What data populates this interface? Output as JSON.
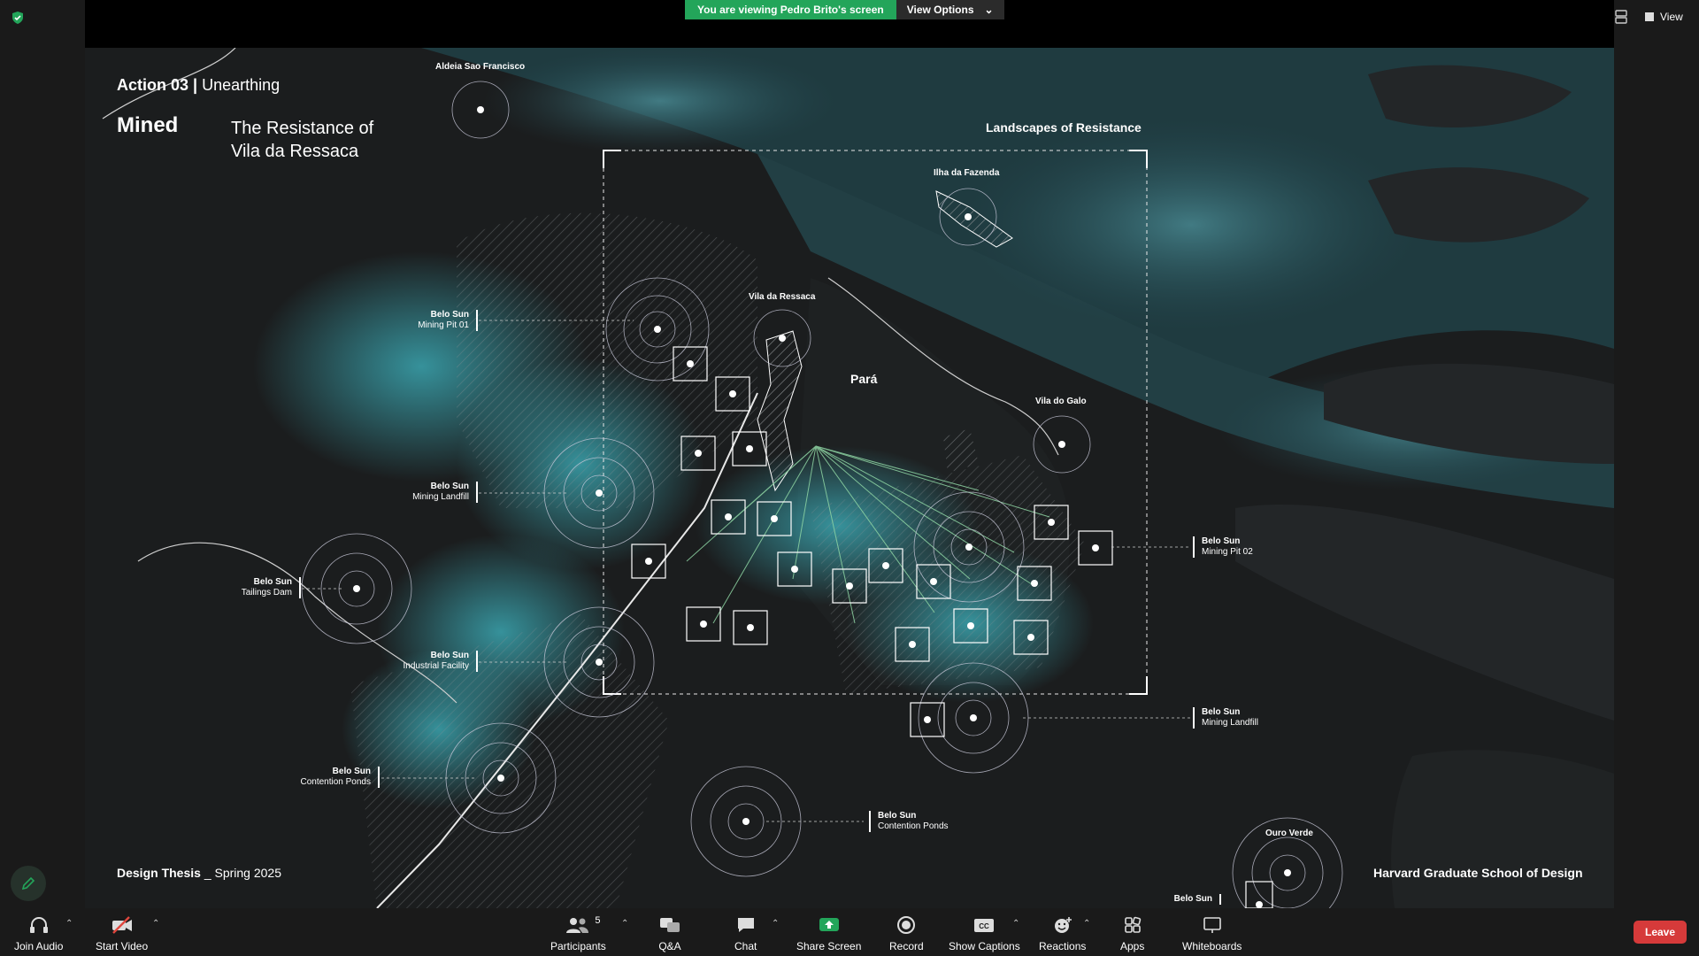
{
  "banner": {
    "text": "You are viewing Pedro Brito's screen",
    "view_options": "View Options"
  },
  "top_right": {
    "view_label": "View"
  },
  "slide": {
    "action": "Action 03",
    "action_sub": "Unearthing",
    "mined": "Mined",
    "subtitle_line1": "The Resistance of",
    "subtitle_line2": "Vila da Ressaca",
    "landscapes": "Landscapes of Resistance",
    "footer_left_bold": "Design Thesis",
    "footer_left_rest": "_ Spring 2025",
    "footer_right": "Harvard Graduate School of Design",
    "para": "Pará",
    "places": {
      "aldeia": "Aldeia Sao Francisco",
      "ilha": "Ilha da Fazenda",
      "ressaca": "Vila da Ressaca",
      "galo": "Vila do Galo",
      "ouro": "Ouro Verde"
    },
    "sites": [
      {
        "l1": "Belo Sun",
        "l2": "Mining Pit 01"
      },
      {
        "l1": "Belo Sun",
        "l2": "Mining Landfill"
      },
      {
        "l1": "Belo Sun",
        "l2": "Tailings Dam"
      },
      {
        "l1": "Belo Sun",
        "l2": "Industrial Facility"
      },
      {
        "l1": "Belo Sun",
        "l2": "Contention Ponds"
      },
      {
        "l1": "Belo Sun",
        "l2": "Contention Ponds"
      },
      {
        "l1": "Belo Sun",
        "l2": "Mining Pit 02"
      },
      {
        "l1": "Belo Sun",
        "l2": "Mining Landfill"
      },
      {
        "l1": "Belo Sun",
        "l2": ""
      }
    ]
  },
  "toolbar": {
    "join_audio": "Join Audio",
    "start_video": "Start Video",
    "participants": "Participants",
    "participants_count": "5",
    "qa": "Q&A",
    "chat": "Chat",
    "share_screen": "Share Screen",
    "record": "Record",
    "show_captions": "Show Captions",
    "reactions": "Reactions",
    "apps": "Apps",
    "whiteboards": "Whiteboards",
    "leave": "Leave"
  },
  "colors": {
    "accent_green": "#23a55a",
    "teal": "#3fb8c4",
    "leave_red": "#d63a3a"
  }
}
